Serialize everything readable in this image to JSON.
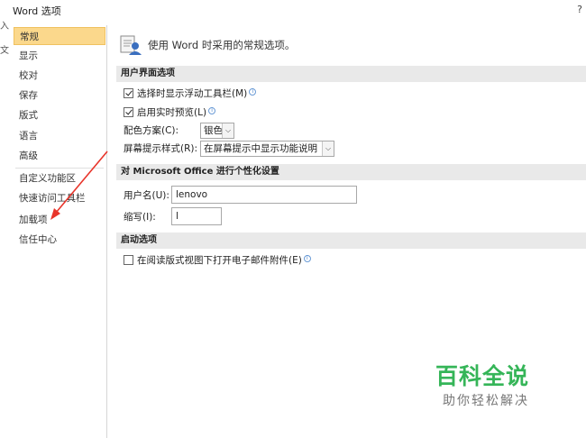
{
  "window": {
    "title": "Word 选项",
    "help": "?"
  },
  "background_fragments": [
    "入",
    "文"
  ],
  "sidebar": {
    "items": [
      {
        "label": "常规",
        "active": true
      },
      {
        "label": "显示"
      },
      {
        "label": "校对"
      },
      {
        "label": "保存"
      },
      {
        "label": "版式"
      },
      {
        "label": "语言"
      },
      {
        "label": "高级"
      },
      {
        "label": "自定义功能区"
      },
      {
        "label": "快速访问工具栏"
      },
      {
        "label": "加载项"
      },
      {
        "label": "信任中心"
      }
    ]
  },
  "content": {
    "header_text": "使用 Word 时采用的常规选项。",
    "section_ui": {
      "title": "用户界面选项",
      "opt_minitoolbar": "选择时显示浮动工具栏(M)",
      "opt_livepreview": "启用实时预览(L)",
      "color_scheme_label": "配色方案(C):",
      "color_scheme_value": "银色",
      "screentip_label": "屏幕提示样式(R):",
      "screentip_value": "在屏幕提示中显示功能说明"
    },
    "section_personalize": {
      "title": "对 Microsoft Office 进行个性化设置",
      "username_label": "用户名(U):",
      "username_value": "lenovo",
      "initials_label": "缩写(I):",
      "initials_value": "l"
    },
    "section_startup": {
      "title": "启动选项",
      "opt_reading_layout": "在阅读版式视图下打开电子邮件附件(E)"
    }
  },
  "watermark": {
    "main": "百科全说",
    "sub": "助你轻松解决"
  },
  "colors": {
    "active_nav": "#fbd88c",
    "annotation_arrow": "#e8342a",
    "watermark_green": "#35b558"
  }
}
